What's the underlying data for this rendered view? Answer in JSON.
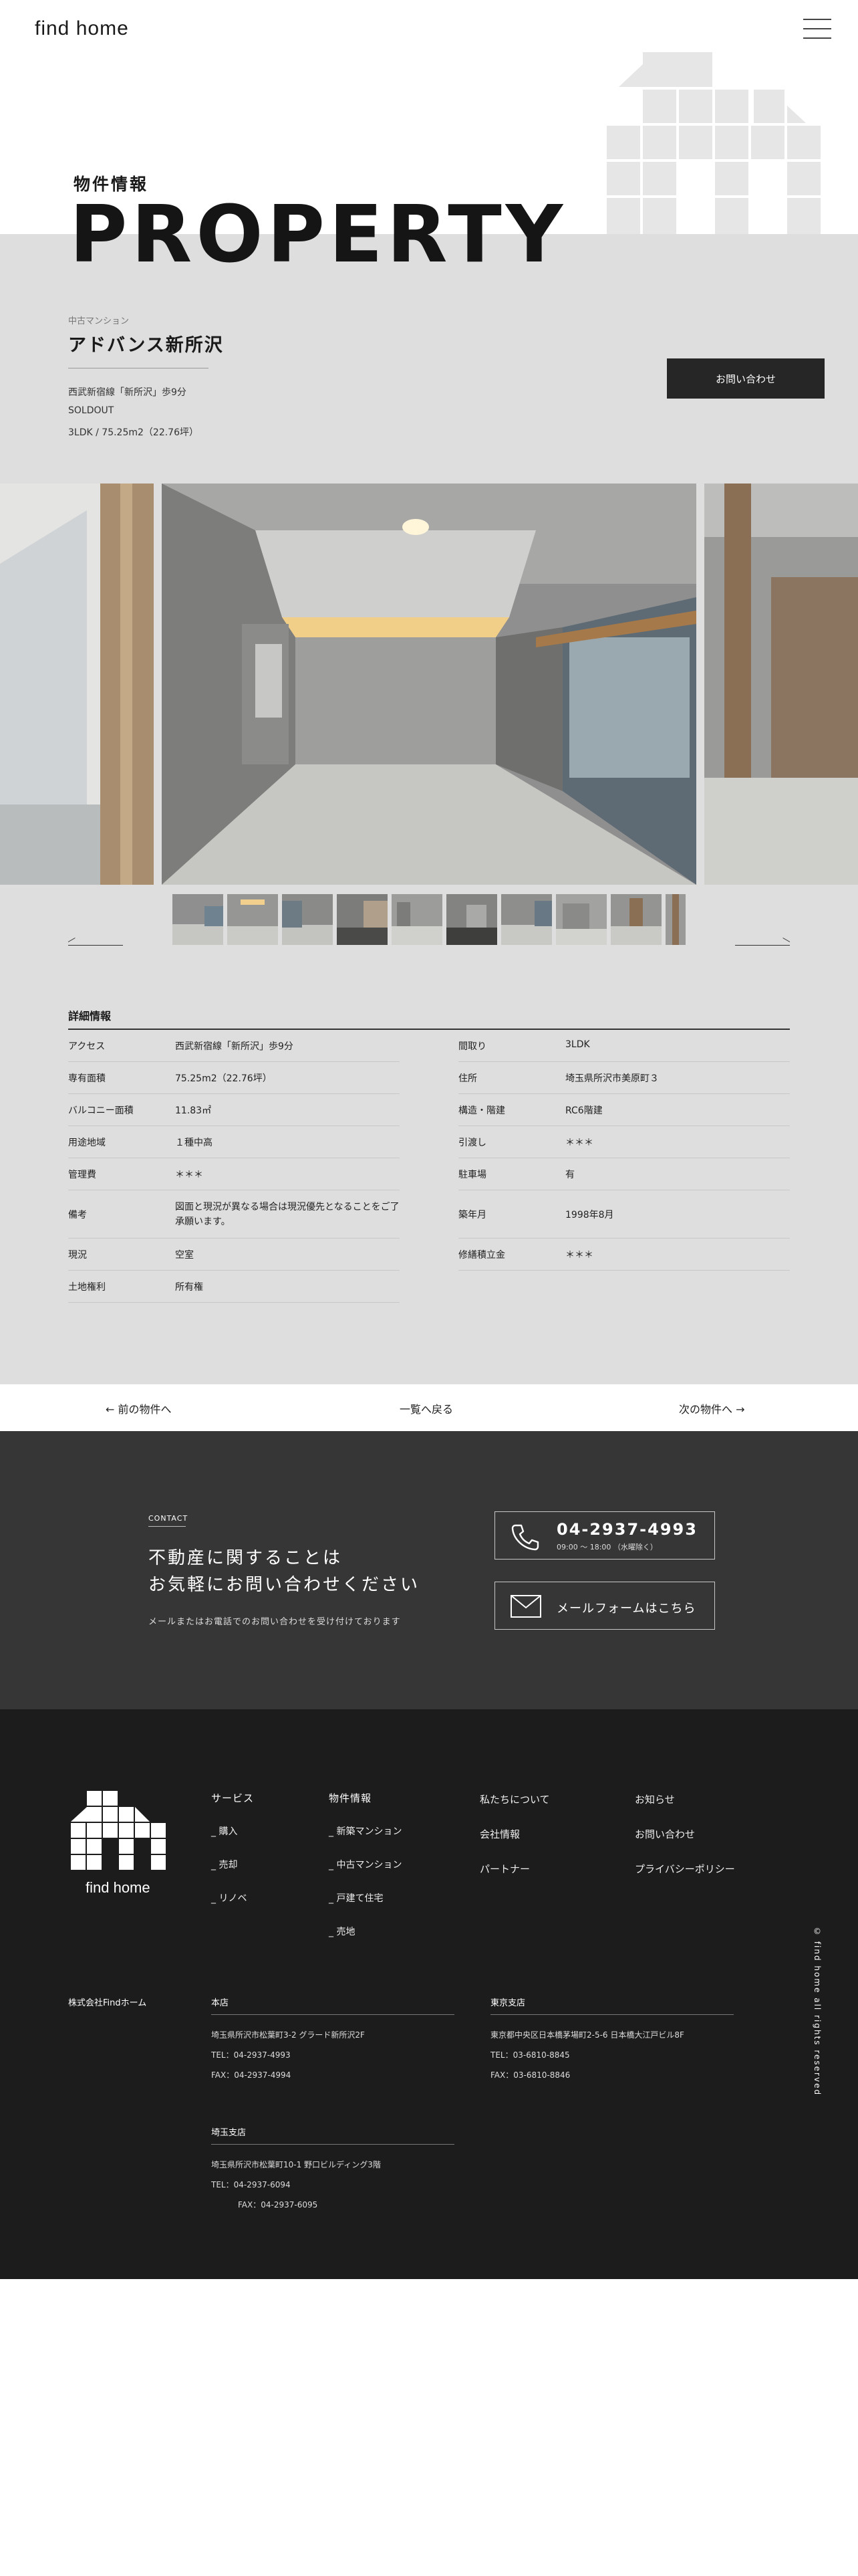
{
  "header": {
    "logo": "find home",
    "menu_icon": "hamburger-icon"
  },
  "hero": {
    "subtitle": "物件情報",
    "title": "PROPERTY"
  },
  "property": {
    "category": "中古マンション",
    "name": "アドバンス新所沢",
    "access": "西武新宿線「新所沢」歩9分",
    "status": "SOLDOUT",
    "spec": "3LDK / 75.25m2（22.76坪）",
    "inquiry_button": "お問い合わせ"
  },
  "gallery": {
    "thumb_count": 10,
    "prev_icon": "arrow-left-icon",
    "next_icon": "arrow-right-icon"
  },
  "details": {
    "title": "詳細情報",
    "left": [
      {
        "k": "アクセス",
        "v": "西武新宿線「新所沢」歩9分"
      },
      {
        "k": "専有面積",
        "v": "75.25m2（22.76坪）"
      },
      {
        "k": "バルコニー面積",
        "v": "11.83㎡"
      },
      {
        "k": "用途地域",
        "v": "１種中高"
      },
      {
        "k": "管理費",
        "v": "＊＊＊"
      },
      {
        "k": "備考",
        "v": "図面と現況が異なる場合は現況優先となることをご了承願います。"
      },
      {
        "k": "現況",
        "v": "空室"
      },
      {
        "k": "土地権利",
        "v": "所有権"
      }
    ],
    "right": [
      {
        "k": "間取り",
        "v": "3LDK"
      },
      {
        "k": "住所",
        "v": "埼玉県所沢市美原町３"
      },
      {
        "k": "構造・階建",
        "v": "RC6階建"
      },
      {
        "k": "引渡し",
        "v": "＊＊＊"
      },
      {
        "k": "駐車場",
        "v": "有"
      },
      {
        "k": "築年月",
        "v": "1998年8月"
      },
      {
        "k": "修繕積立金",
        "v": "＊＊＊"
      }
    ]
  },
  "pager": {
    "prev": "← 前の物件へ",
    "list": "一覧へ戻る",
    "next": "次の物件へ →"
  },
  "contact": {
    "tag": "CONTACT",
    "heading_1": "不動産に関することは",
    "heading_2": "お気軽にお問い合わせください",
    "note": "メールまたはお電話でのお問い合わせを受け付けております",
    "tel": "04-2937-4993",
    "hours": "09:00 ～ 18:00 （水曜除く）",
    "mail_label": "メールフォームはこちら"
  },
  "footer": {
    "logo": "find home",
    "nav_service_title": "サービス",
    "nav_service": [
      "_ 購入",
      "_ 売却",
      "_ リノベ"
    ],
    "nav_property_title": "物件情報",
    "nav_property": [
      "_ 新築マンション",
      "_ 中古マンション",
      "_ 戸建て住宅",
      "_ 売地"
    ],
    "nav_about": [
      "私たちについて",
      "会社情報",
      "パートナー"
    ],
    "nav_info": [
      "お知らせ",
      "お問い合わせ",
      "プライバシーポリシー"
    ],
    "company": "株式会社Findホーム",
    "head_office": {
      "title": "本店",
      "address": "埼玉県所沢市松葉町3-2 グラード新所沢2F",
      "tel": "TEL：04-2937-4993",
      "fax": "FAX：04-2937-4994"
    },
    "tokyo_office": {
      "title": "東京支店",
      "address": "東京都中央区日本橋茅場町2-5-6 日本橋大江戸ビル8F",
      "tel": "TEL：03-6810-8845",
      "fax": "FAX：03-6810-8846"
    },
    "saitama_office": {
      "title": "埼玉支店",
      "address": "埼玉県所沢市松葉町10-1 野口ビルディング3階",
      "tel": "TEL：04-2937-6094",
      "fax": "FAX：04-2937-6095"
    },
    "copyright": "© find home all rights reserved"
  },
  "colors": {
    "band": "#dedede",
    "dark": "#363636",
    "footer": "#1c1c1c",
    "button": "#262626"
  }
}
